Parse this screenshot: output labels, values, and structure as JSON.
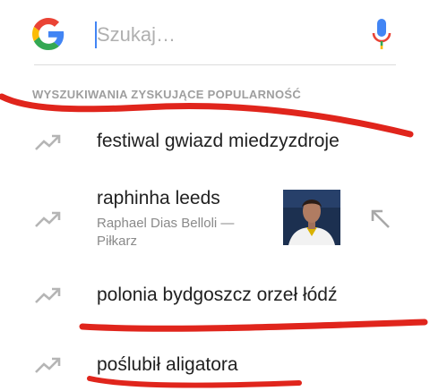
{
  "search": {
    "placeholder": "Szukaj…"
  },
  "icons": {
    "logo": "google-g-icon",
    "mic": "microphone-icon",
    "trend": "trending-up-icon",
    "fill": "arrow-up-left-icon"
  },
  "colors": {
    "google_blue": "#4285f4",
    "google_red": "#ea4335",
    "google_yellow": "#fbbc05",
    "google_green": "#34a853",
    "marker_red": "#e0251c"
  },
  "section": {
    "title": "WYSZUKIWANIA ZYSKUJĄCE POPULARNOŚĆ"
  },
  "suggestions": [
    {
      "title": "festiwal gwiazd miedzyzdroje"
    },
    {
      "title": "raphinha leeds",
      "subtitle_1": "Raphael Dias Belloli —",
      "subtitle_2": "Piłkarz"
    },
    {
      "title": "polonia bydgoszcz orzeł łódź"
    },
    {
      "title": "poślubił aligatora"
    }
  ]
}
